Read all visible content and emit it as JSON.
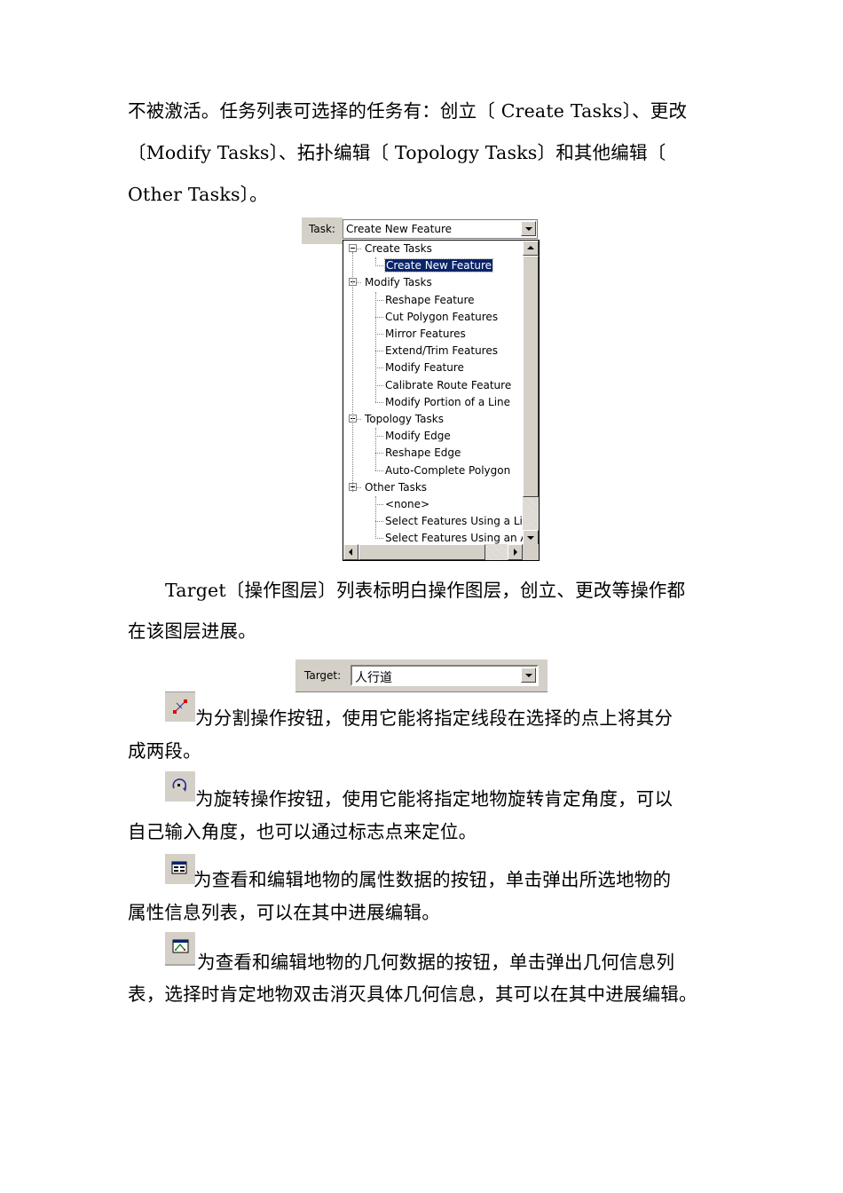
{
  "intro_paragraph": {
    "lines": [
      "不被激活。任务列表可选择的任务有：创立〔 Create  Tasks〕、更改",
      "〔Modify  Tasks〕、拓扑编辑〔 Topology  Tasks〕和其他编辑〔",
      "Other Tasks〕。"
    ]
  },
  "task_widget": {
    "label": "Task:",
    "selected_value": "Create New Feature",
    "groups": [
      {
        "label": "Create Tasks",
        "items": [
          "Create New Feature"
        ]
      },
      {
        "label": "Modify Tasks",
        "items": [
          "Reshape Feature",
          "Cut Polygon Features",
          "Mirror Features",
          "Extend/Trim Features",
          "Modify Feature",
          "Calibrate Route Feature",
          "Modify Portion of a Line"
        ]
      },
      {
        "label": "Topology Tasks",
        "items": [
          "Modify Edge",
          "Reshape Edge",
          "Auto-Complete Polygon"
        ]
      },
      {
        "label": "Other Tasks",
        "items": [
          "<none>",
          "Select Features Using a Lir",
          "Select Features Using an A"
        ]
      }
    ],
    "selected_color": "#0a246a"
  },
  "target_paragraph": {
    "lines": [
      "Target〔操作图层〕列表标明白操作图层，创立、更改等操作都",
      "在该图层进展。"
    ]
  },
  "target_widget": {
    "label": "Target:",
    "selected_value": "人行道"
  },
  "tool_descriptions": [
    {
      "icon": "split-tool-icon",
      "lines": [
        "为分割操作按钮，使用它能将指定线段在选择的点上将其分",
        "成两段。"
      ]
    },
    {
      "icon": "rotate-tool-icon",
      "lines": [
        "为旋转操作按钮，使用它能将指定地物旋转肯定角度，可以",
        "自己输入角度，也可以通过标志点来定位。"
      ]
    },
    {
      "icon": "attributes-tool-icon",
      "lines": [
        "为查看和编辑地物的属性数据的按钮，单击弹出所选地物的",
        "属性信息列表，可以在其中进展编辑。"
      ]
    },
    {
      "icon": "sketch-properties-tool-icon",
      "lines": [
        "为查看和编辑地物的几何数据的按钮，单击弹出几何信息列",
        "表，选择时肯定地物双击消灭具体几何信息，其可以在其中进展编辑。"
      ]
    }
  ]
}
